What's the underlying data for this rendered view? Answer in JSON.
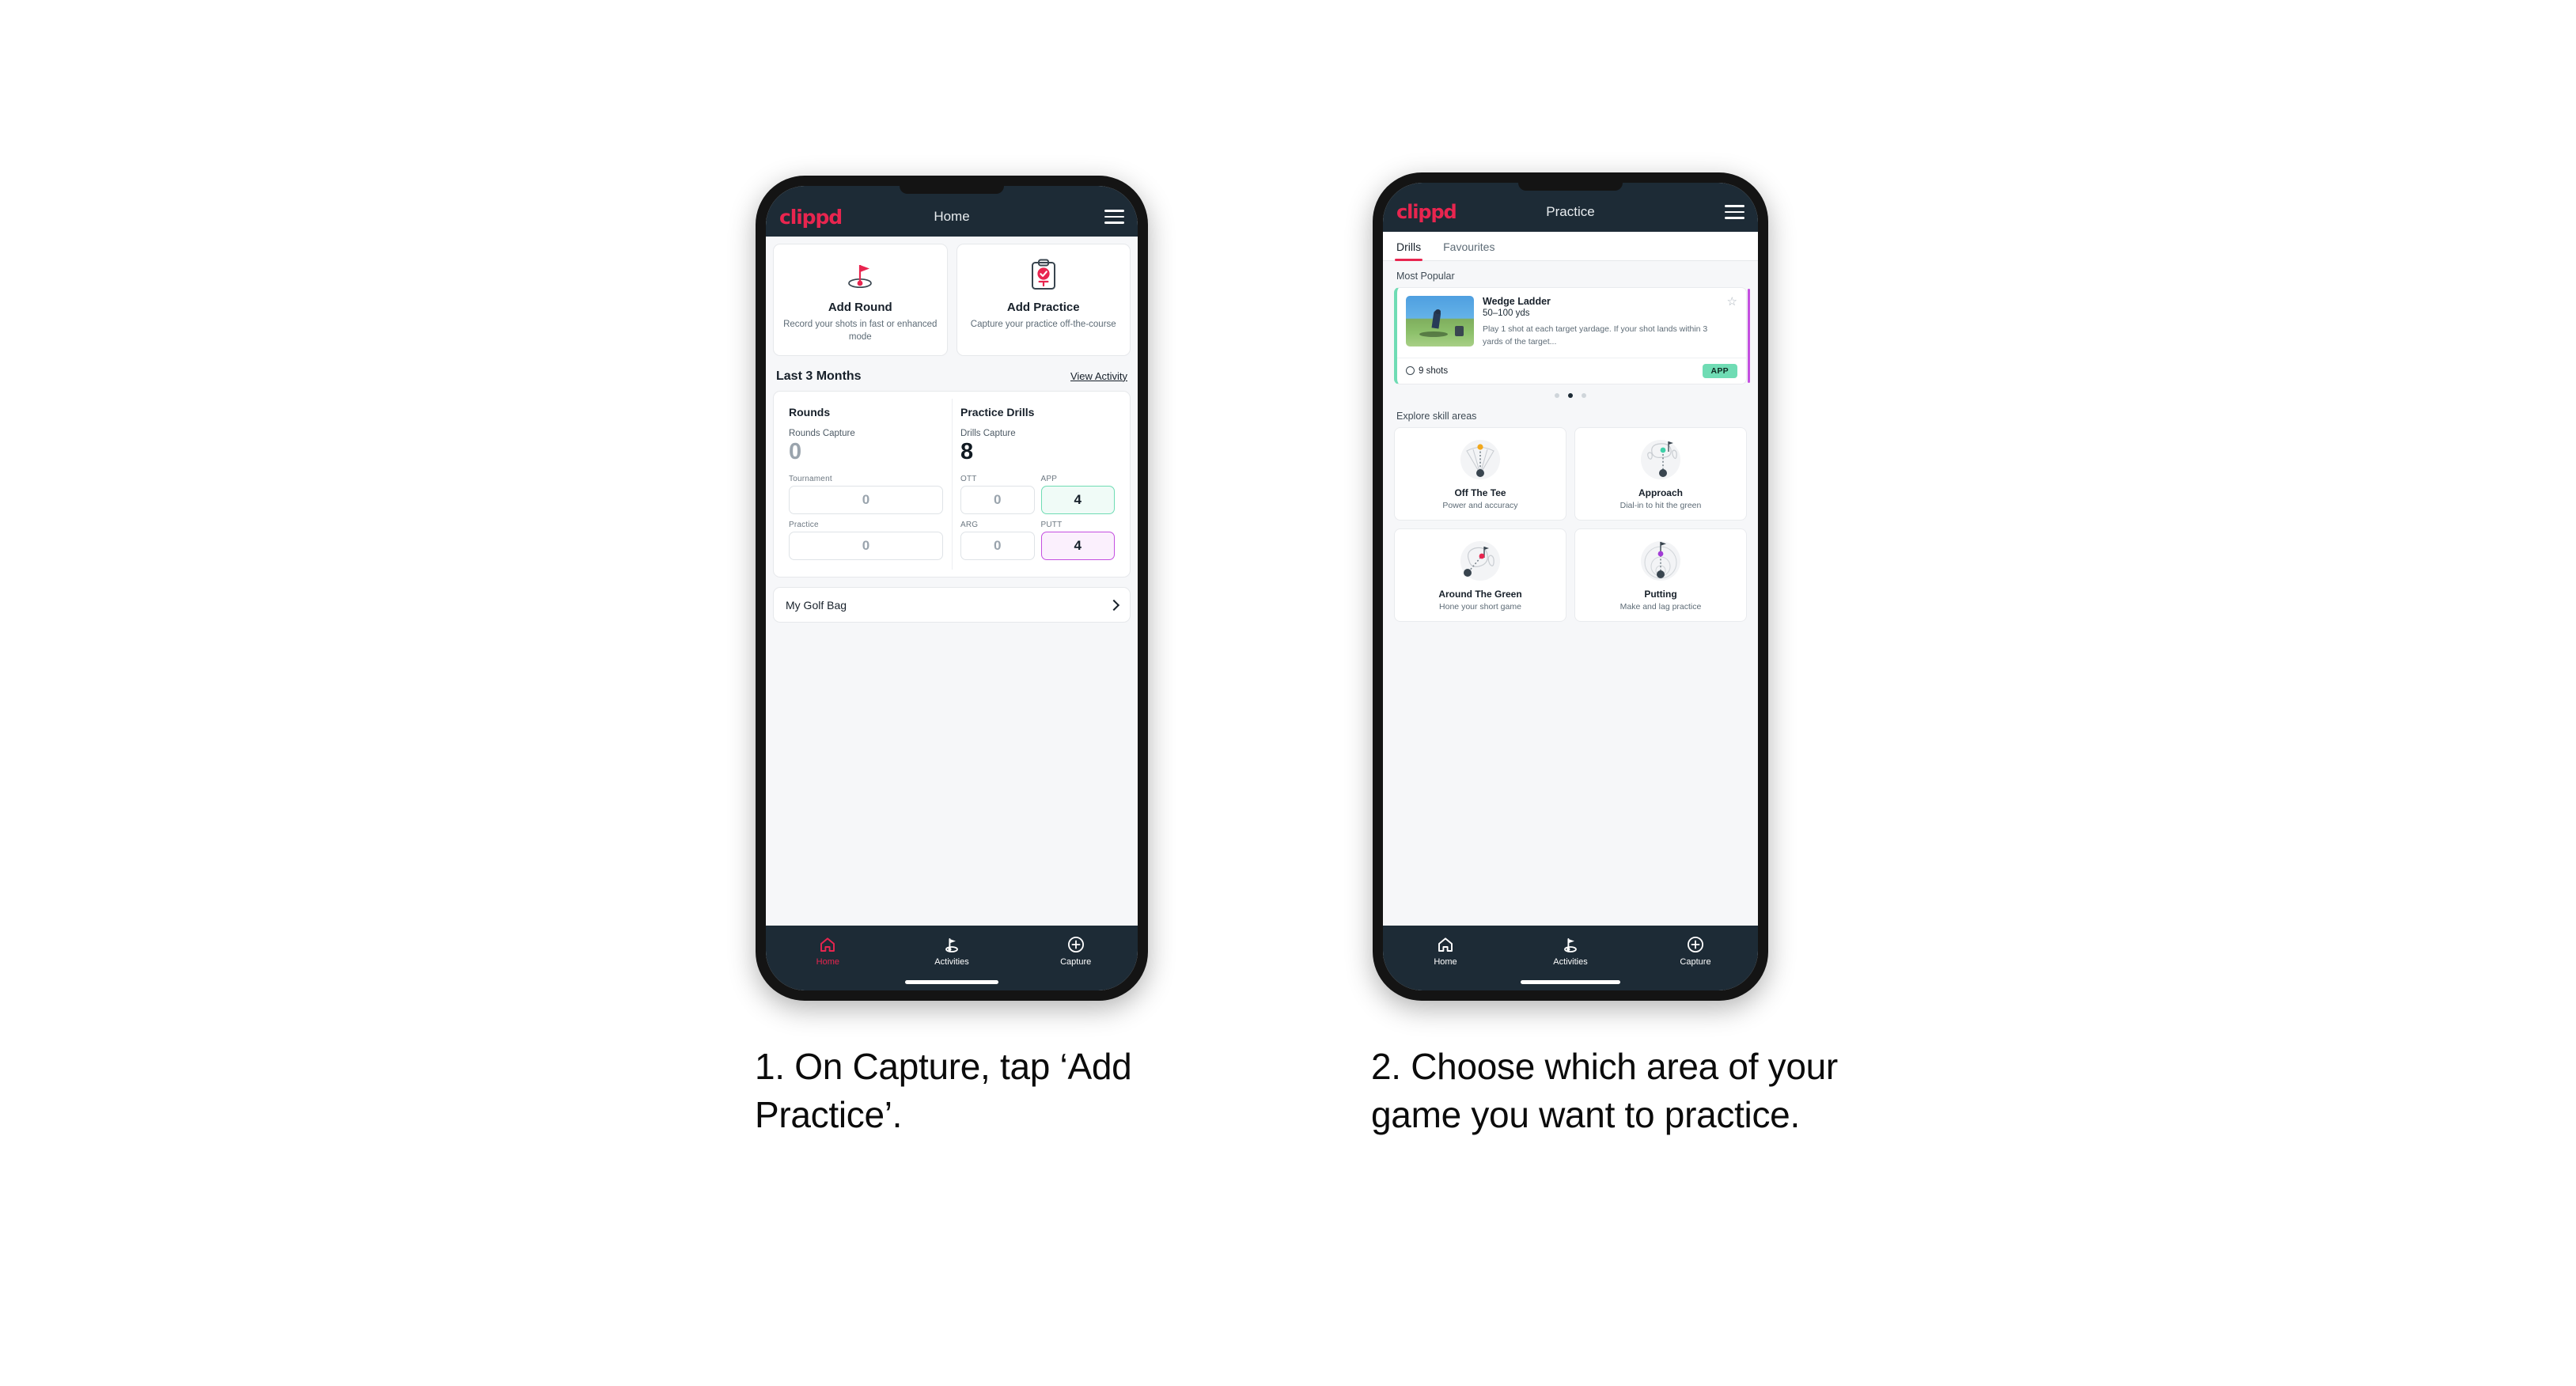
{
  "phone1": {
    "appbar": {
      "brand": "clippd",
      "title": "Home",
      "menu_icon": "hamburger-icon"
    },
    "actions": [
      {
        "icon": "flag-hole-icon",
        "title": "Add Round",
        "subtitle": "Record your shots in fast or enhanced mode"
      },
      {
        "icon": "clipboard-check-icon",
        "title": "Add Practice",
        "subtitle": "Capture your practice off-the-course"
      }
    ],
    "section": {
      "title": "Last 3 Months",
      "link": "View Activity"
    },
    "rounds": {
      "title": "Rounds",
      "capture_label": "Rounds Capture",
      "capture_value": "0",
      "tiles": [
        {
          "label": "Tournament",
          "value": "0",
          "state": "default"
        },
        {
          "label": "Practice",
          "value": "0",
          "state": "default"
        }
      ]
    },
    "drills": {
      "title": "Practice Drills",
      "capture_label": "Drills Capture",
      "capture_value": "8",
      "tiles": [
        {
          "label": "OTT",
          "value": "0",
          "state": "default"
        },
        {
          "label": "APP",
          "value": "4",
          "state": "app"
        },
        {
          "label": "ARG",
          "value": "0",
          "state": "default"
        },
        {
          "label": "PUTT",
          "value": "4",
          "state": "putt"
        }
      ]
    },
    "golf_bag": {
      "label": "My Golf Bag",
      "chevron": "chevron-right-icon"
    },
    "nav": [
      {
        "label": "Home",
        "icon": "home-icon",
        "active": true
      },
      {
        "label": "Activities",
        "icon": "golf-flag-icon",
        "active": false
      },
      {
        "label": "Capture",
        "icon": "plus-circle-icon",
        "active": false
      }
    ]
  },
  "phone2": {
    "appbar": {
      "brand": "clippd",
      "title": "Practice",
      "menu_icon": "hamburger-icon"
    },
    "tabs": [
      {
        "label": "Drills",
        "active": true
      },
      {
        "label": "Favourites",
        "active": false
      }
    ],
    "most_popular_label": "Most Popular",
    "drill_card": {
      "title": "Wedge Ladder",
      "yardage": "50–100 yds",
      "description": "Play 1 shot at each target yardage. If your shot lands within 3 yards of the target...",
      "shots": "9 shots",
      "badge": "APP",
      "star_icon": "star-outline-icon",
      "clock_icon": "clock-icon",
      "thumbnail": "golfer-photo"
    },
    "carousel_dots": {
      "count": 3,
      "active_index": 1
    },
    "skill_label": "Explore skill areas",
    "skills": [
      {
        "title": "Off The Tee",
        "subtitle": "Power and accuracy",
        "icon": "tee-shot-cone-icon",
        "accent": "#f2a81d"
      },
      {
        "title": "Approach",
        "subtitle": "Dial-in to hit the green",
        "icon": "approach-green-icon",
        "accent": "#3fd0a8"
      },
      {
        "title": "Around The Green",
        "subtitle": "Hone your short game",
        "icon": "chip-green-icon",
        "accent": "#e8254f"
      },
      {
        "title": "Putting",
        "subtitle": "Make and lag practice",
        "icon": "putting-rings-icon",
        "accent": "#a23cd6"
      }
    ],
    "nav": [
      {
        "label": "Home",
        "icon": "home-icon",
        "active": false
      },
      {
        "label": "Activities",
        "icon": "golf-flag-icon",
        "active": false
      },
      {
        "label": "Capture",
        "icon": "plus-circle-icon",
        "active": false
      }
    ]
  },
  "captions": {
    "step1": "1. On Capture, tap ‘Add Practice’.",
    "step2": "2. Choose which area of your game you want to practice."
  },
  "colors": {
    "brand_pink": "#e8254f",
    "navy": "#1d2b36",
    "mint": "#6fdcb4",
    "purple": "#c44fe0"
  }
}
